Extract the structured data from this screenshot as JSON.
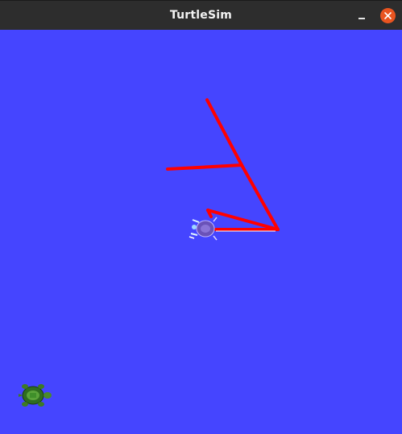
{
  "window": {
    "title": "TurtleSim"
  },
  "titlebar_buttons": {
    "minimize_icon": "minimize-icon",
    "close_icon": "close-icon"
  },
  "colors": {
    "background": "#4545ff",
    "pen": "#ff0000",
    "titlebar": "#2d2d2d",
    "close_button": "#e95420"
  },
  "turtles": [
    {
      "name": "turtle-main",
      "icon": "turtle-icon",
      "color": "#7a5fbf"
    },
    {
      "name": "turtle-corner",
      "icon": "turtle-icon",
      "color": "#3f8f2a"
    }
  ]
}
